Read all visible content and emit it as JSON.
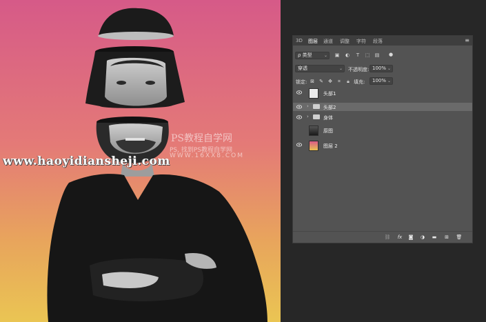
{
  "watermark": {
    "url": "www.haoyidiansheji.com",
    "title": "PS教程自学网",
    "subtitle": "PS, 找到PS教程自学网",
    "site": "WWW.16XX8.COM"
  },
  "layers_panel": {
    "tabs": [
      "3D",
      "图层",
      "通道",
      "调整",
      "字符",
      "段落"
    ],
    "active_tab": "图层",
    "filter": {
      "label": "ρ 类型"
    },
    "blend_mode": "穿透",
    "opacity": {
      "label": "不透明度:",
      "value": "100%"
    },
    "lock": {
      "label": "锁定:"
    },
    "fill": {
      "label": "填充:",
      "value": "100%"
    },
    "layers": [
      {
        "name": "头部1",
        "visible": true,
        "type": "layer",
        "thumb": "#e8e8e8"
      },
      {
        "name": "头部2",
        "visible": true,
        "type": "group",
        "selected": true
      },
      {
        "name": "身体",
        "visible": true,
        "type": "group"
      },
      {
        "name": "原图",
        "visible": false,
        "type": "photo"
      },
      {
        "name": "图层 2",
        "visible": true,
        "type": "gradient"
      }
    ],
    "footer_icons": [
      "link-icon",
      "fx-icon",
      "mask-icon",
      "adjustment-icon",
      "folder-icon",
      "new-layer-icon",
      "trash-icon"
    ]
  },
  "colors": {
    "gradient_top": "#d95a86",
    "gradient_mid": "#e4787a",
    "gradient_bottom": "#e8c250",
    "panel_bg": "#535353"
  }
}
